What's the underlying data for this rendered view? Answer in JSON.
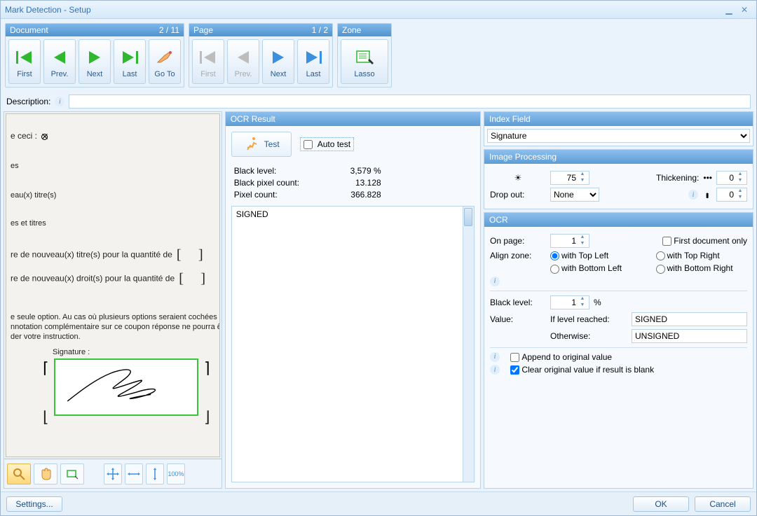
{
  "title": "Mark Detection - Setup",
  "ribbon": {
    "document": {
      "label": "Document",
      "count": "2 / 11",
      "first": "First",
      "prev": "Prev.",
      "next": "Next",
      "last": "Last",
      "goto": "Go To"
    },
    "page": {
      "label": "Page",
      "count": "1 / 2",
      "first": "First",
      "prev": "Prev.",
      "next": "Next",
      "last": "Last"
    },
    "zone": {
      "label": "Zone",
      "lasso": "Lasso"
    }
  },
  "description_label": "Description:",
  "description_value": "",
  "preview": {
    "l1": "e ceci :",
    "l2": "es",
    "l3": "eau(x) titre(s)",
    "l4": "es et titres",
    "l5": "re de nouveau(x) titre(s) pour la quantité de",
    "l6": "re de nouveau(x) droit(s) pour la quantité de",
    "l7a": "e seule option. Au cas où plusieurs options seraient cochées",
    "l7b": "nnotation complémentaire sur ce coupon réponse ne pourra être",
    "l7c": "der votre instruction.",
    "sig_label": "Signature :"
  },
  "ocr": {
    "header": "OCR Result",
    "test": "Test",
    "auto_test": "Auto test",
    "black_level_lbl": "Black level:",
    "black_level_val": "3,579  %",
    "black_px_lbl": "Black pixel count:",
    "black_px_val": "13.128",
    "px_lbl": "Pixel count:",
    "px_val": "366.828",
    "result": "SIGNED"
  },
  "index_field": {
    "header": "Index Field",
    "selected": "Signature"
  },
  "image_processing": {
    "header": "Image Processing",
    "brightness": "75",
    "thickening_lbl": "Thickening:",
    "thickening_val": "0",
    "dropout_lbl": "Drop out:",
    "dropout_val": "None",
    "extra_val": "0"
  },
  "ocr_cfg": {
    "header": "OCR",
    "on_page_lbl": "On page:",
    "on_page_val": "1",
    "first_doc_only": "First document only",
    "align_zone_lbl": "Align zone:",
    "topleft": "with Top Left",
    "topright": "with Top Right",
    "bottomleft": "with Bottom Left",
    "bottomright": "with Bottom Right",
    "black_level_lbl": "Black level:",
    "black_level_val": "1",
    "pct": "%",
    "value_lbl": "Value:",
    "if_reached_lbl": "If level reached:",
    "if_reached_val": "SIGNED",
    "otherwise_lbl": "Otherwise:",
    "otherwise_val": "UNSIGNED",
    "append": "Append to original value",
    "clear_blank": "Clear original value if result is blank"
  },
  "buttons": {
    "settings": "Settings...",
    "ok": "OK",
    "cancel": "Cancel"
  },
  "tool_100": "100%"
}
